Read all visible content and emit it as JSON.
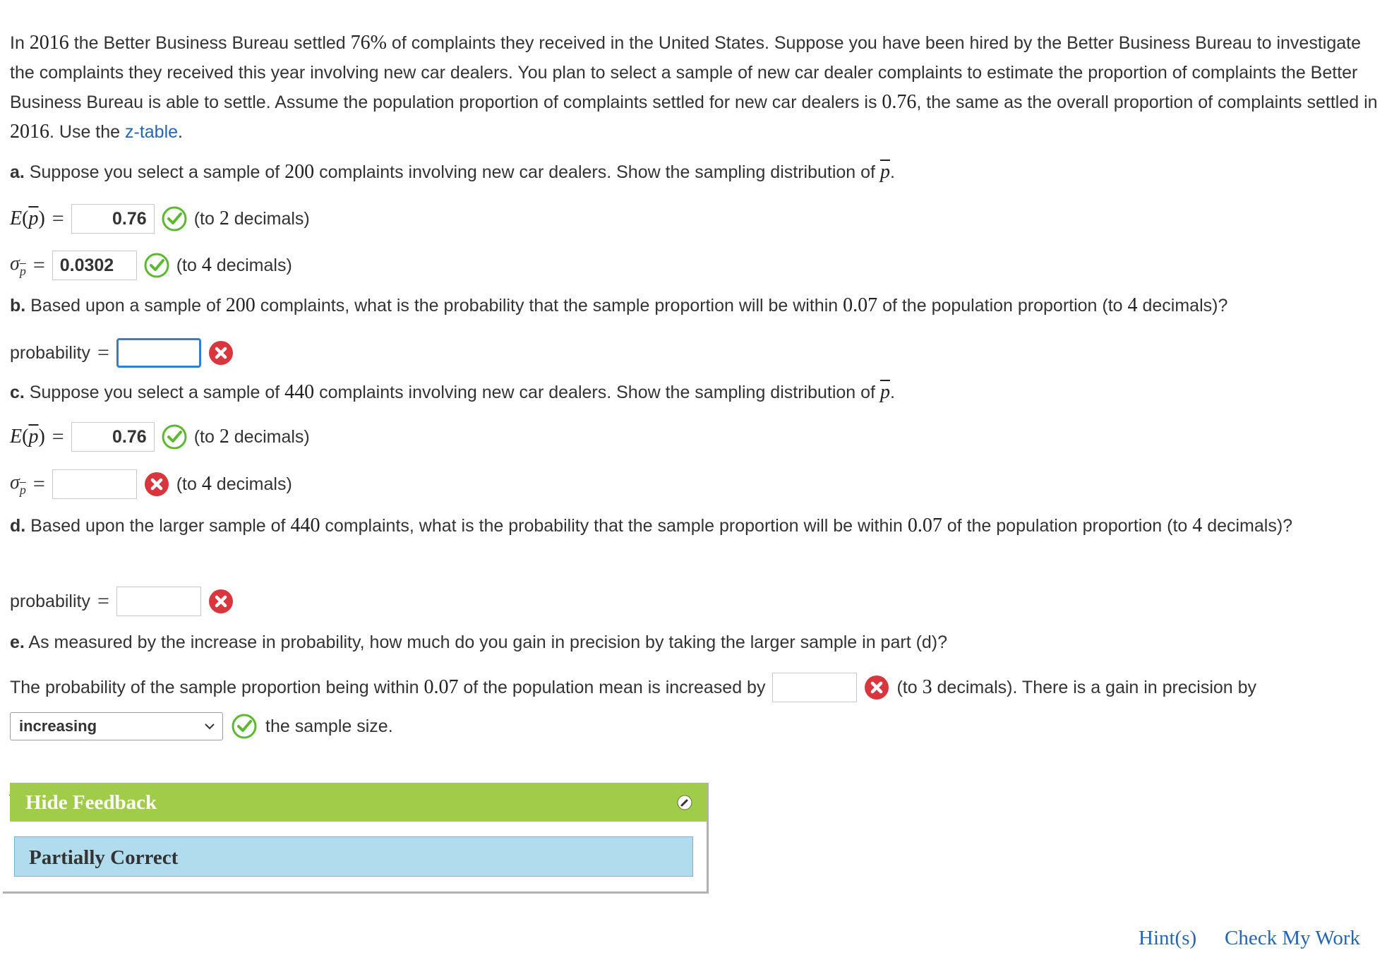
{
  "intro": {
    "t1": "In ",
    "n1": "2016",
    "t2": " the Better Business Bureau settled ",
    "n2": "76%",
    "t3": " of complaints they received in the United States. Suppose you have been hired by the Better Business Bureau to investigate the complaints they received this year involving new car dealers. You plan to select a sample of new car dealer complaints to estimate the proportion of complaints the Better Business Bureau is able to settle. Assume the population proportion of complaints settled for new car dealers is ",
    "n3": "0.76",
    "t4": ", the same as the overall proportion of complaints settled in ",
    "n4": "2016",
    "t5": ". Use the ",
    "link": "z-table",
    "t6": "."
  },
  "a": {
    "letter": "a.",
    "t1": " Suppose you select a sample of ",
    "n1": "200",
    "t2": " complaints involving new car dealers. Show the sampling distribution of ",
    "pbar": "p",
    "t3": ".",
    "e_label": "E",
    "e_value": "0.76",
    "e_hint_pre": "(to ",
    "e_hint_n": "2",
    "e_hint_post": " decimals)",
    "s_value": "0.0302",
    "s_hint_pre": "(to ",
    "s_hint_n": "4",
    "s_hint_post": " decimals)"
  },
  "b": {
    "letter": "b.",
    "t1": " Based upon a sample of ",
    "n1": "200",
    "t2": " complaints, what is the probability that the sample proportion will be within ",
    "n2": "0.07",
    "t3": " of the population proportion (to ",
    "n3": "4",
    "t4": " decimals)?",
    "prob_label": "probability",
    "prob_value": ""
  },
  "c": {
    "letter": "c.",
    "t1": " Suppose you select a sample of ",
    "n1": "440",
    "t2": " complaints involving new car dealers. Show the sampling distribution of ",
    "pbar": "p",
    "t3": ".",
    "e_value": "0.76",
    "e_hint_pre": "(to ",
    "e_hint_n": "2",
    "e_hint_post": " decimals)",
    "s_value": "",
    "s_hint_pre": "(to ",
    "s_hint_n": "4",
    "s_hint_post": " decimals)"
  },
  "d": {
    "letter": "d.",
    "t1": " Based upon the larger sample of ",
    "n1": "440",
    "t2": " complaints, what is the probability that the sample proportion will be within ",
    "n2": "0.07",
    "t3": " of the population proportion (to ",
    "n3": "4",
    "t4": " decimals)?",
    "prob_label": "probability",
    "prob_value": ""
  },
  "e": {
    "letter": "e.",
    "t1": " As measured by the increase in probability, how much do you gain in precision by taking the larger sample in part (d)?",
    "s1": "The probability of the sample proportion being within ",
    "n1": "0.07",
    "s2": " of the population mean is increased by",
    "value": "",
    "s3_pre": "(to ",
    "s3_n": "3",
    "s3_post": " decimals). There is a gain in precision by",
    "select_value": "increasing",
    "s4": "the sample size."
  },
  "feedback": {
    "title": "Hide Feedback",
    "status": "Partially Correct"
  },
  "links": {
    "hint": "Hint(s)",
    "check": "Check My Work"
  },
  "colors": {
    "correct": "#5cb82e",
    "incorrect": "#d9353d",
    "feedback_bar": "#a1cc4a",
    "feedback_body": "#b1dced",
    "link": "#2366b3"
  }
}
